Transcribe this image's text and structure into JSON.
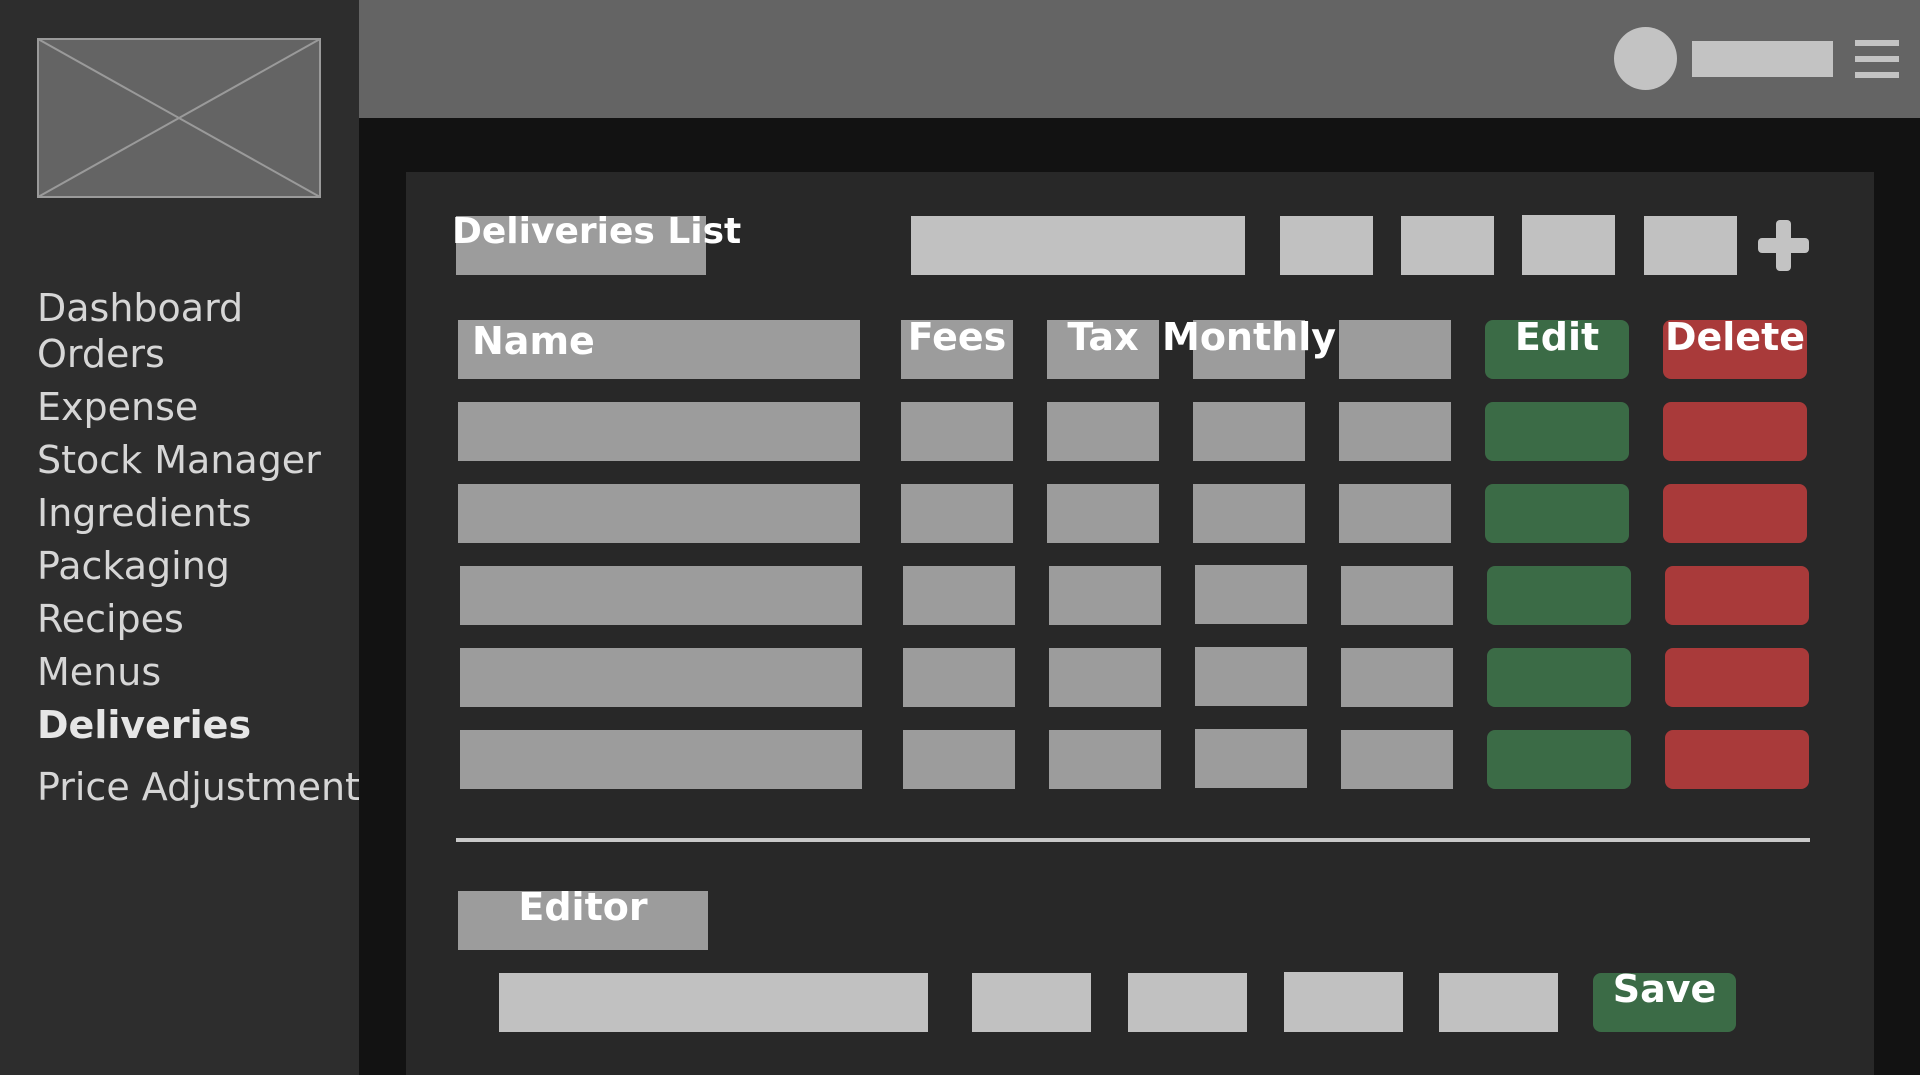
{
  "sidebar": {
    "items": [
      {
        "label": "Dashboard"
      },
      {
        "label": "Orders"
      },
      {
        "label": "Expense"
      },
      {
        "label": "Stock Manager"
      },
      {
        "label": "Ingredients"
      },
      {
        "label": "Packaging"
      },
      {
        "label": "Recipes"
      },
      {
        "label": "Menus"
      },
      {
        "label": "Deliveries"
      },
      {
        "label": "Price Adjustment"
      }
    ],
    "active": "Deliveries"
  },
  "list": {
    "title": "Deliveries List",
    "headers": {
      "name": "Name",
      "fees": "Fees",
      "tax": "Tax",
      "monthly": "Monthly",
      "edit": "Edit",
      "delete": "Delete"
    }
  },
  "editor": {
    "title": "Editor",
    "save_label": "Save"
  },
  "colors": {
    "edit_green": "#3b6b46",
    "delete_red": "#a93a3a",
    "placeholder_gray": "#9c9c9c",
    "input_light": "#c1c1c1"
  },
  "icons": [
    "image-placeholder-icon",
    "avatar-icon",
    "hamburger-menu-icon",
    "plus-icon"
  ]
}
